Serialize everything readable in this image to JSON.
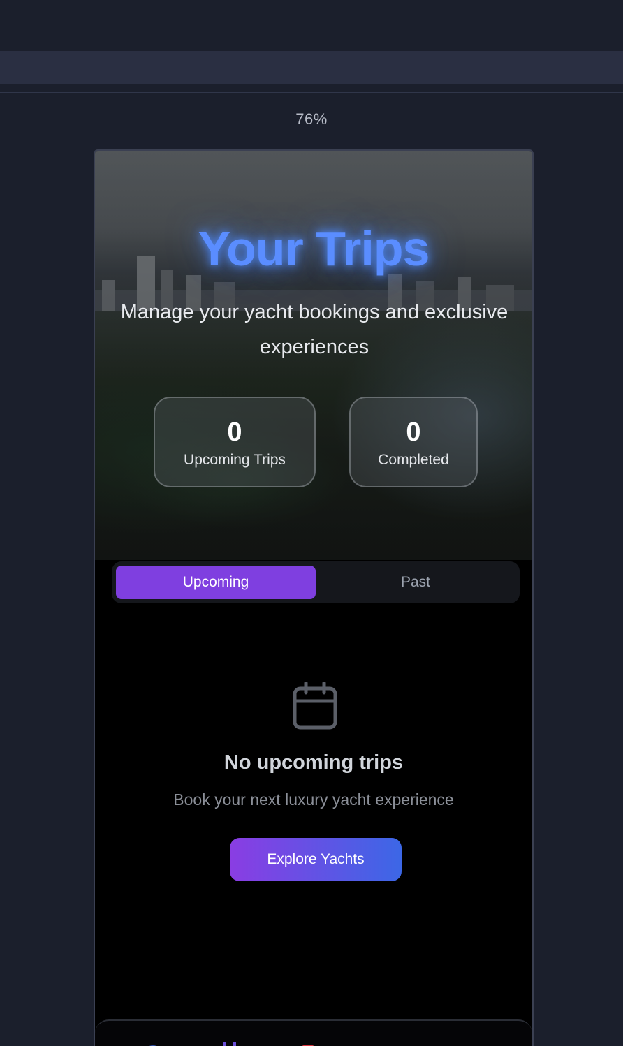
{
  "browser": {
    "zoom": "76%"
  },
  "hero": {
    "title": "Your Trips",
    "subtitle": "Manage your yacht bookings and exclusive experiences"
  },
  "stats": [
    {
      "value": "0",
      "label": "Upcoming Trips"
    },
    {
      "value": "0",
      "label": "Completed"
    }
  ],
  "tabs": {
    "upcoming_label": "Upcoming",
    "past_label": "Past",
    "active": "Upcoming"
  },
  "empty_state": {
    "icon": "calendar-icon",
    "title": "No upcoming trips",
    "subtitle": "Book your next luxury yacht experience",
    "button_label": "Explore Yachts"
  },
  "bottom_nav": {
    "icons": [
      "home-icon",
      "calendar-icon",
      "bookings-icon",
      "profile-icon"
    ]
  },
  "colors": {
    "accent_purple": "#7f3fe0",
    "accent_blue": "#3c67e6",
    "title_glow": "#5a8dff",
    "page_background": "#1b1f2c"
  }
}
